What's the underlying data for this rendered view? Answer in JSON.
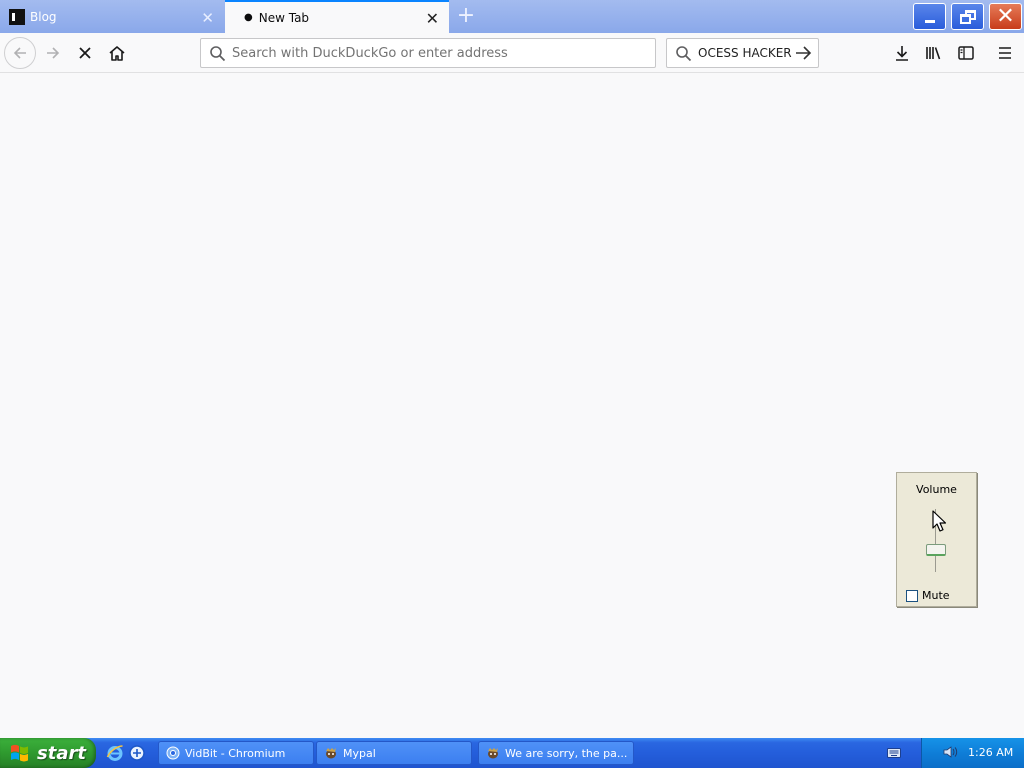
{
  "tabs": [
    {
      "label": "Blog",
      "active": false
    },
    {
      "label": "New Tab",
      "active": true
    }
  ],
  "toolbar": {
    "url_placeholder": "Search with DuckDuckGo or enter address",
    "url_value": "",
    "search_text": "OCESS HACKER"
  },
  "icons": {
    "back": "arrow-left-icon",
    "forward": "arrow-right-icon",
    "stop": "stop-x-icon",
    "home": "home-icon",
    "search": "magnifier-icon",
    "go": "arrow-right-icon",
    "downloads": "download-arrow-icon",
    "library": "library-icon",
    "sidebar": "sidebar-icon",
    "menu": "hamburger-icon"
  },
  "volume": {
    "title": "Volume",
    "level": 0.35,
    "mute_label": "Mute",
    "muted": false
  },
  "taskbar": {
    "start_label": "start",
    "tasks": [
      {
        "label": "VidBit - Chromium"
      },
      {
        "label": "Mypal"
      },
      {
        "label": "We are sorry, the pa..."
      }
    ],
    "clock": "1:26 AM"
  },
  "colors": {
    "tab_strip": "#8aa8ea",
    "active_tab_accent": "#0a84ff",
    "content_background": "#f9f9fa",
    "taskbar": "#245edb",
    "start_button": "#2f9a2f",
    "close_button": "#c83c1a"
  }
}
